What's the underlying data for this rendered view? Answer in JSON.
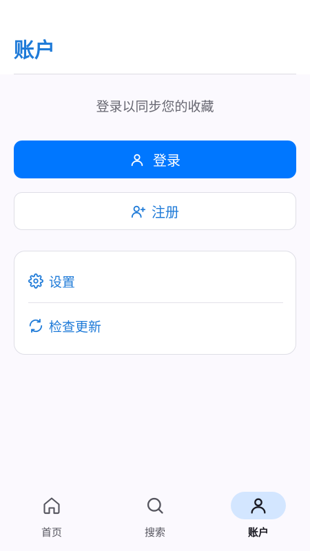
{
  "header": {
    "title": "账户"
  },
  "prompt": {
    "text": "登录以同步您的收藏"
  },
  "actions": {
    "login_label": "登录",
    "register_label": "注册"
  },
  "menu": {
    "items": [
      {
        "label": "设置",
        "icon": "gear-icon"
      },
      {
        "label": "检查更新",
        "icon": "refresh-icon"
      }
    ]
  },
  "nav": {
    "items": [
      {
        "label": "首页",
        "icon": "home-icon",
        "active": false
      },
      {
        "label": "搜索",
        "icon": "search-icon",
        "active": false
      },
      {
        "label": "账户",
        "icon": "person-icon",
        "active": true
      }
    ]
  },
  "colors": {
    "accent": "#1f7bd8",
    "primary_button": "#0077ff",
    "active_nav_pill": "#d3e6ff",
    "background": "#fbf9fe"
  }
}
